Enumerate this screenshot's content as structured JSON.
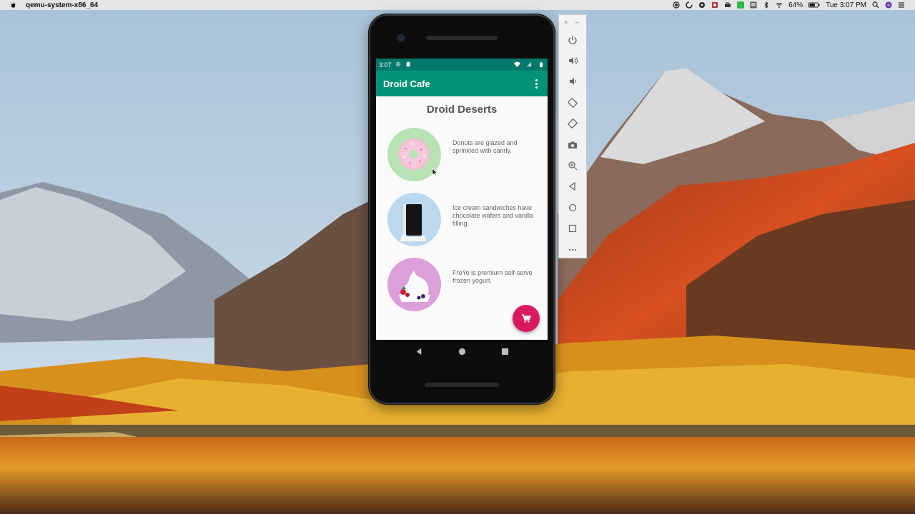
{
  "menubar": {
    "app_name": "qemu-system-x86_64",
    "battery": "64%",
    "clock": "Tue 3:07 PM",
    "icons": [
      "record-icon",
      "sync-icon",
      "cloud-icon",
      "screen-icon",
      "green-app-icon",
      "display-icon",
      "bluetooth-icon",
      "wifi-icon",
      "battery-icon",
      "search-icon",
      "siri-icon",
      "notifications-icon"
    ]
  },
  "phone": {
    "status_bar": {
      "time": "3:07"
    },
    "app_bar": {
      "title": "Droid Cafe"
    },
    "heading": "Droid Deserts",
    "items": [
      {
        "name": "donut",
        "description": "Donuts are glazed and sprinkled with candy."
      },
      {
        "name": "ice-cream-sandwich",
        "description": "Ice cream sandwiches have chocolate wafers and vanilla filling."
      },
      {
        "name": "froyo",
        "description": "FroYo is premium self-serve frozen yogurt."
      }
    ],
    "fab_icon": "shopping-cart-icon",
    "nav_buttons": [
      "back-icon",
      "home-icon",
      "recents-icon"
    ]
  },
  "emulator_toolbar": {
    "window_buttons": [
      "×",
      "–"
    ],
    "buttons": [
      "power-icon",
      "volume-up-icon",
      "volume-down-icon",
      "rotate-left-icon",
      "rotate-right-icon",
      "camera-icon",
      "zoom-icon",
      "back-icon",
      "home-icon",
      "overview-icon",
      "more-icon"
    ]
  },
  "colors": {
    "status_bar": "#00796b",
    "app_bar": "#009475",
    "fab": "#d81b60"
  }
}
